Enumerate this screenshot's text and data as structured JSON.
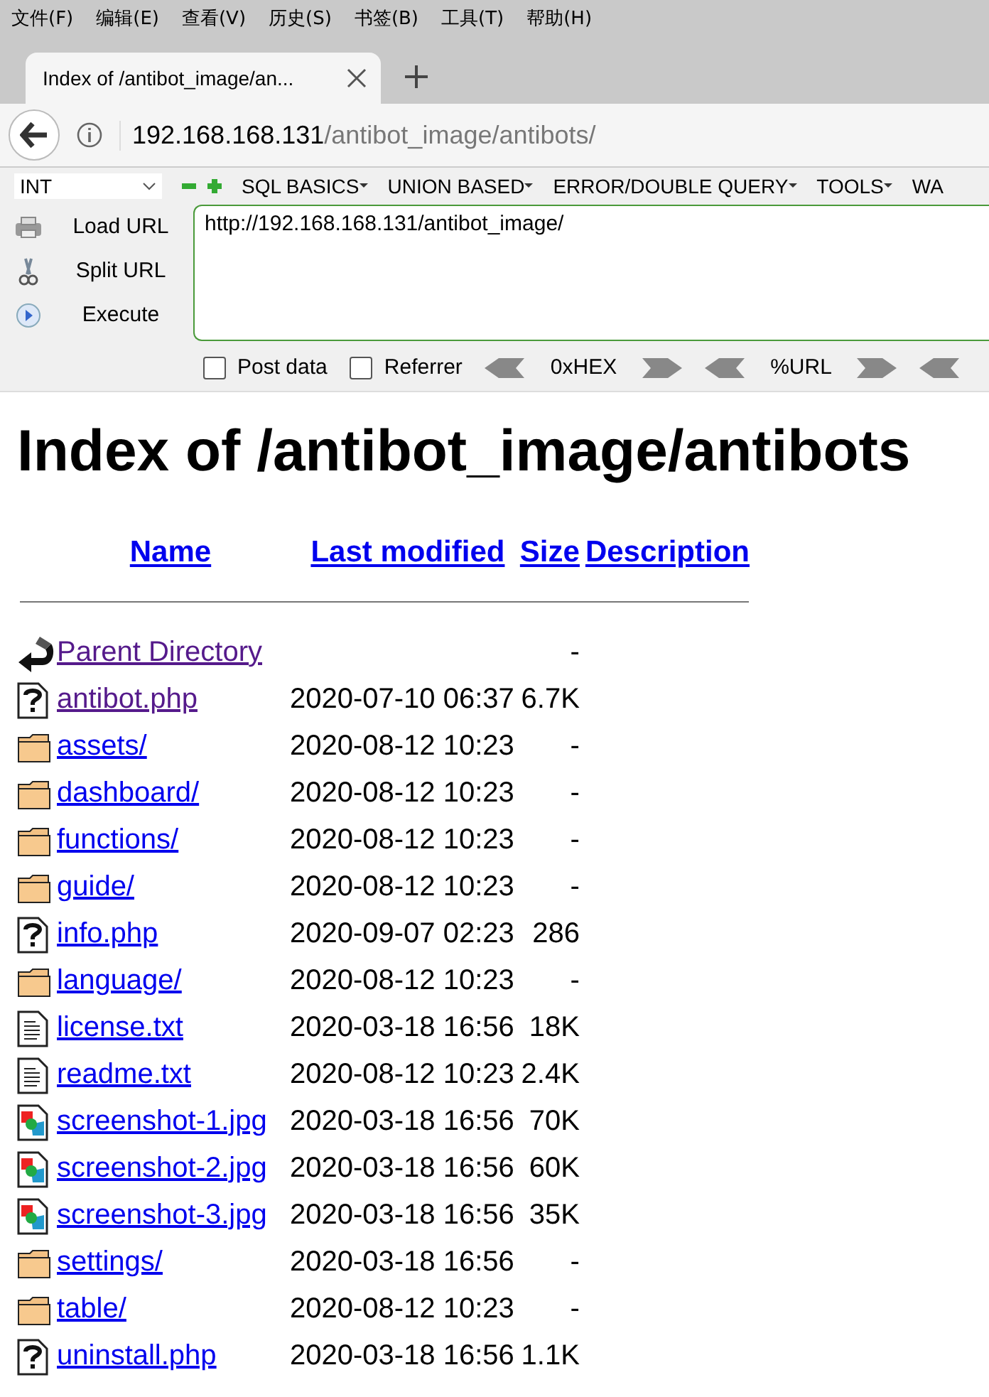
{
  "menu": [
    "文件(F)",
    "编辑(E)",
    "查看(V)",
    "历史(S)",
    "书签(B)",
    "工具(T)",
    "帮助(H)"
  ],
  "tabs": [
    {
      "title": "Index of /antibot_image/an...",
      "selected": true
    }
  ],
  "address": {
    "host": "192.168.168.131",
    "path": "/antibot_image/antibots/"
  },
  "hackbar": {
    "type_select": "INT",
    "menus": [
      "SQL BASICS",
      "UNION BASED",
      "ERROR/DOUBLE QUERY",
      "TOOLS",
      "WA"
    ],
    "actions": [
      "Load URL",
      "Split URL",
      "Execute"
    ],
    "url_value": "http://192.168.168.131/antibot_image/",
    "options": [
      {
        "label": "Post data",
        "checked": false
      },
      {
        "label": "Referrer",
        "checked": false
      }
    ],
    "encoders": [
      "0xHEX",
      "%URL"
    ]
  },
  "heading": "Index of /antibot_image/antibots",
  "table": {
    "columns": [
      "Name",
      "Last modified",
      "Size",
      "Description"
    ],
    "rows": [
      {
        "kind": "back",
        "name": "Parent Directory",
        "visited": true,
        "modified": "",
        "size": "-"
      },
      {
        "kind": "unknown",
        "name": "antibot.php",
        "visited": true,
        "modified": "2020-07-10 06:37",
        "size": "6.7K"
      },
      {
        "kind": "folder",
        "name": "assets/",
        "visited": false,
        "modified": "2020-08-12 10:23",
        "size": "-"
      },
      {
        "kind": "folder",
        "name": "dashboard/",
        "visited": false,
        "modified": "2020-08-12 10:23",
        "size": "-"
      },
      {
        "kind": "folder",
        "name": "functions/",
        "visited": false,
        "modified": "2020-08-12 10:23",
        "size": "-"
      },
      {
        "kind": "folder",
        "name": "guide/",
        "visited": false,
        "modified": "2020-08-12 10:23",
        "size": "-"
      },
      {
        "kind": "unknown",
        "name": "info.php",
        "visited": false,
        "modified": "2020-09-07 02:23",
        "size": "286"
      },
      {
        "kind": "folder",
        "name": "language/",
        "visited": false,
        "modified": "2020-08-12 10:23",
        "size": "-"
      },
      {
        "kind": "text",
        "name": "license.txt",
        "visited": false,
        "modified": "2020-03-18 16:56",
        "size": "18K"
      },
      {
        "kind": "text",
        "name": "readme.txt",
        "visited": false,
        "modified": "2020-08-12 10:23",
        "size": "2.4K"
      },
      {
        "kind": "image",
        "name": "screenshot-1.jpg",
        "visited": false,
        "modified": "2020-03-18 16:56",
        "size": "70K"
      },
      {
        "kind": "image",
        "name": "screenshot-2.jpg",
        "visited": false,
        "modified": "2020-03-18 16:56",
        "size": "60K"
      },
      {
        "kind": "image",
        "name": "screenshot-3.jpg",
        "visited": false,
        "modified": "2020-03-18 16:56",
        "size": "35K"
      },
      {
        "kind": "folder",
        "name": "settings/",
        "visited": false,
        "modified": "2020-03-18 16:56",
        "size": "-"
      },
      {
        "kind": "folder",
        "name": "table/",
        "visited": false,
        "modified": "2020-08-12 10:23",
        "size": "-"
      },
      {
        "kind": "unknown",
        "name": "uninstall.php",
        "visited": false,
        "modified": "2020-03-18 16:56",
        "size": "1.1K"
      }
    ]
  }
}
